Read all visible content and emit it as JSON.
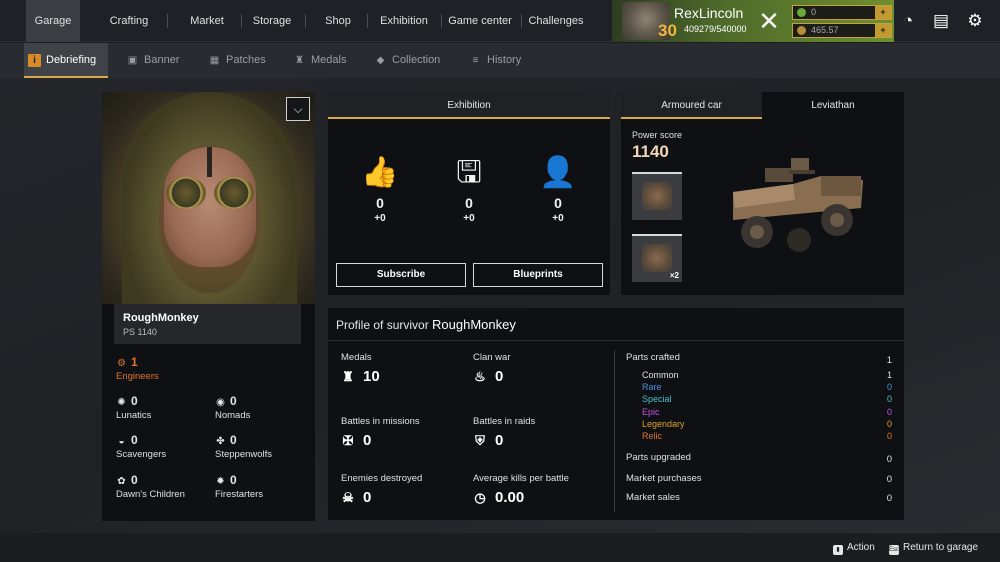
{
  "nav": {
    "items": [
      {
        "label": "Garage"
      },
      {
        "label": "Crafting"
      },
      {
        "label": "Market"
      },
      {
        "label": "Storage"
      },
      {
        "label": "Shop"
      },
      {
        "label": "Exhibition"
      },
      {
        "label": "Game center"
      },
      {
        "label": "Challenges"
      }
    ]
  },
  "player": {
    "name": "RexLincoln",
    "level": "30",
    "xp": "409279/540000",
    "coins": "0",
    "scrap": "465.57"
  },
  "subnav": {
    "items": [
      {
        "label": "Debriefing",
        "icon": "info-icon"
      },
      {
        "label": "Banner",
        "icon": "banner-icon"
      },
      {
        "label": "Patches",
        "icon": "patch-icon"
      },
      {
        "label": "Medals",
        "icon": "medal-icon"
      },
      {
        "label": "Collection",
        "icon": "collection-icon"
      },
      {
        "label": "History",
        "icon": "history-icon"
      }
    ]
  },
  "survivor": {
    "name": "RoughMonkey",
    "ps": "PS 1140"
  },
  "factions": [
    {
      "name": "Engineers",
      "value": "1",
      "icon": "engineers-icon",
      "accent": "#e0752c"
    },
    {
      "name": "Lunatics",
      "value": "0",
      "icon": "lunatics-icon"
    },
    {
      "name": "Nomads",
      "value": "0",
      "icon": "nomads-icon"
    },
    {
      "name": "Scavengers",
      "value": "0",
      "icon": "scavengers-icon"
    },
    {
      "name": "Steppenwolfs",
      "value": "0",
      "icon": "steppenwolfs-icon"
    },
    {
      "name": "Dawn's Children",
      "value": "0",
      "icon": "dawns-children-icon"
    },
    {
      "name": "Firestarters",
      "value": "0",
      "icon": "firestarters-icon"
    }
  ],
  "exhibition": {
    "tab": "Exhibition",
    "stats": [
      {
        "icon": "thumbs-up-icon",
        "value": "0",
        "delta": "+0"
      },
      {
        "icon": "save-blueprint-icon",
        "value": "0",
        "delta": "+0"
      },
      {
        "icon": "subscriber-icon",
        "value": "0",
        "delta": "+0"
      }
    ],
    "subscribe_label": "Subscribe",
    "blueprints_label": "Blueprints"
  },
  "car": {
    "tabs": [
      "Armoured car",
      "Leviathan"
    ],
    "power_label": "Power score",
    "power_value": "1140",
    "parts": [
      {
        "count": ""
      },
      {
        "count": "×2"
      }
    ]
  },
  "profile": {
    "title_prefix": "Profile of survivor",
    "title_name": "RoughMonkey",
    "stats": [
      {
        "label": "Medals",
        "value": "10",
        "icon": "medal-icon"
      },
      {
        "label": "Clan war",
        "value": "0",
        "icon": "flame-icon"
      },
      {
        "label": "Battles in missions",
        "value": "0",
        "icon": "missions-icon"
      },
      {
        "label": "Battles in raids",
        "value": "0",
        "icon": "raid-icon"
      },
      {
        "label": "Enemies destroyed",
        "value": "0",
        "icon": "skull-icon"
      },
      {
        "label": "Average kills per battle",
        "value": "0.00",
        "icon": "kills-gauge-icon"
      }
    ],
    "parts_crafted": {
      "label": "Parts crafted",
      "value": "1"
    },
    "rarities": [
      {
        "label": "Common",
        "value": "1",
        "color": "#e0e0e0"
      },
      {
        "label": "Rare",
        "value": "0",
        "color": "#4a8fe0"
      },
      {
        "label": "Special",
        "value": "0",
        "color": "#4bc0c8"
      },
      {
        "label": "Epic",
        "value": "0",
        "color": "#c053e0"
      },
      {
        "label": "Legendary",
        "value": "0",
        "color": "#e0a030"
      },
      {
        "label": "Relic",
        "value": "0",
        "color": "#e0752c"
      }
    ],
    "parts_upgraded": {
      "label": "Parts upgraded",
      "value": "0"
    },
    "market_purchases": {
      "label": "Market purchases",
      "value": "0"
    },
    "market_sales": {
      "label": "Market sales",
      "value": "0"
    }
  },
  "hints": {
    "action": "Action",
    "return": "Return to garage",
    "esc_key": "Esc"
  }
}
